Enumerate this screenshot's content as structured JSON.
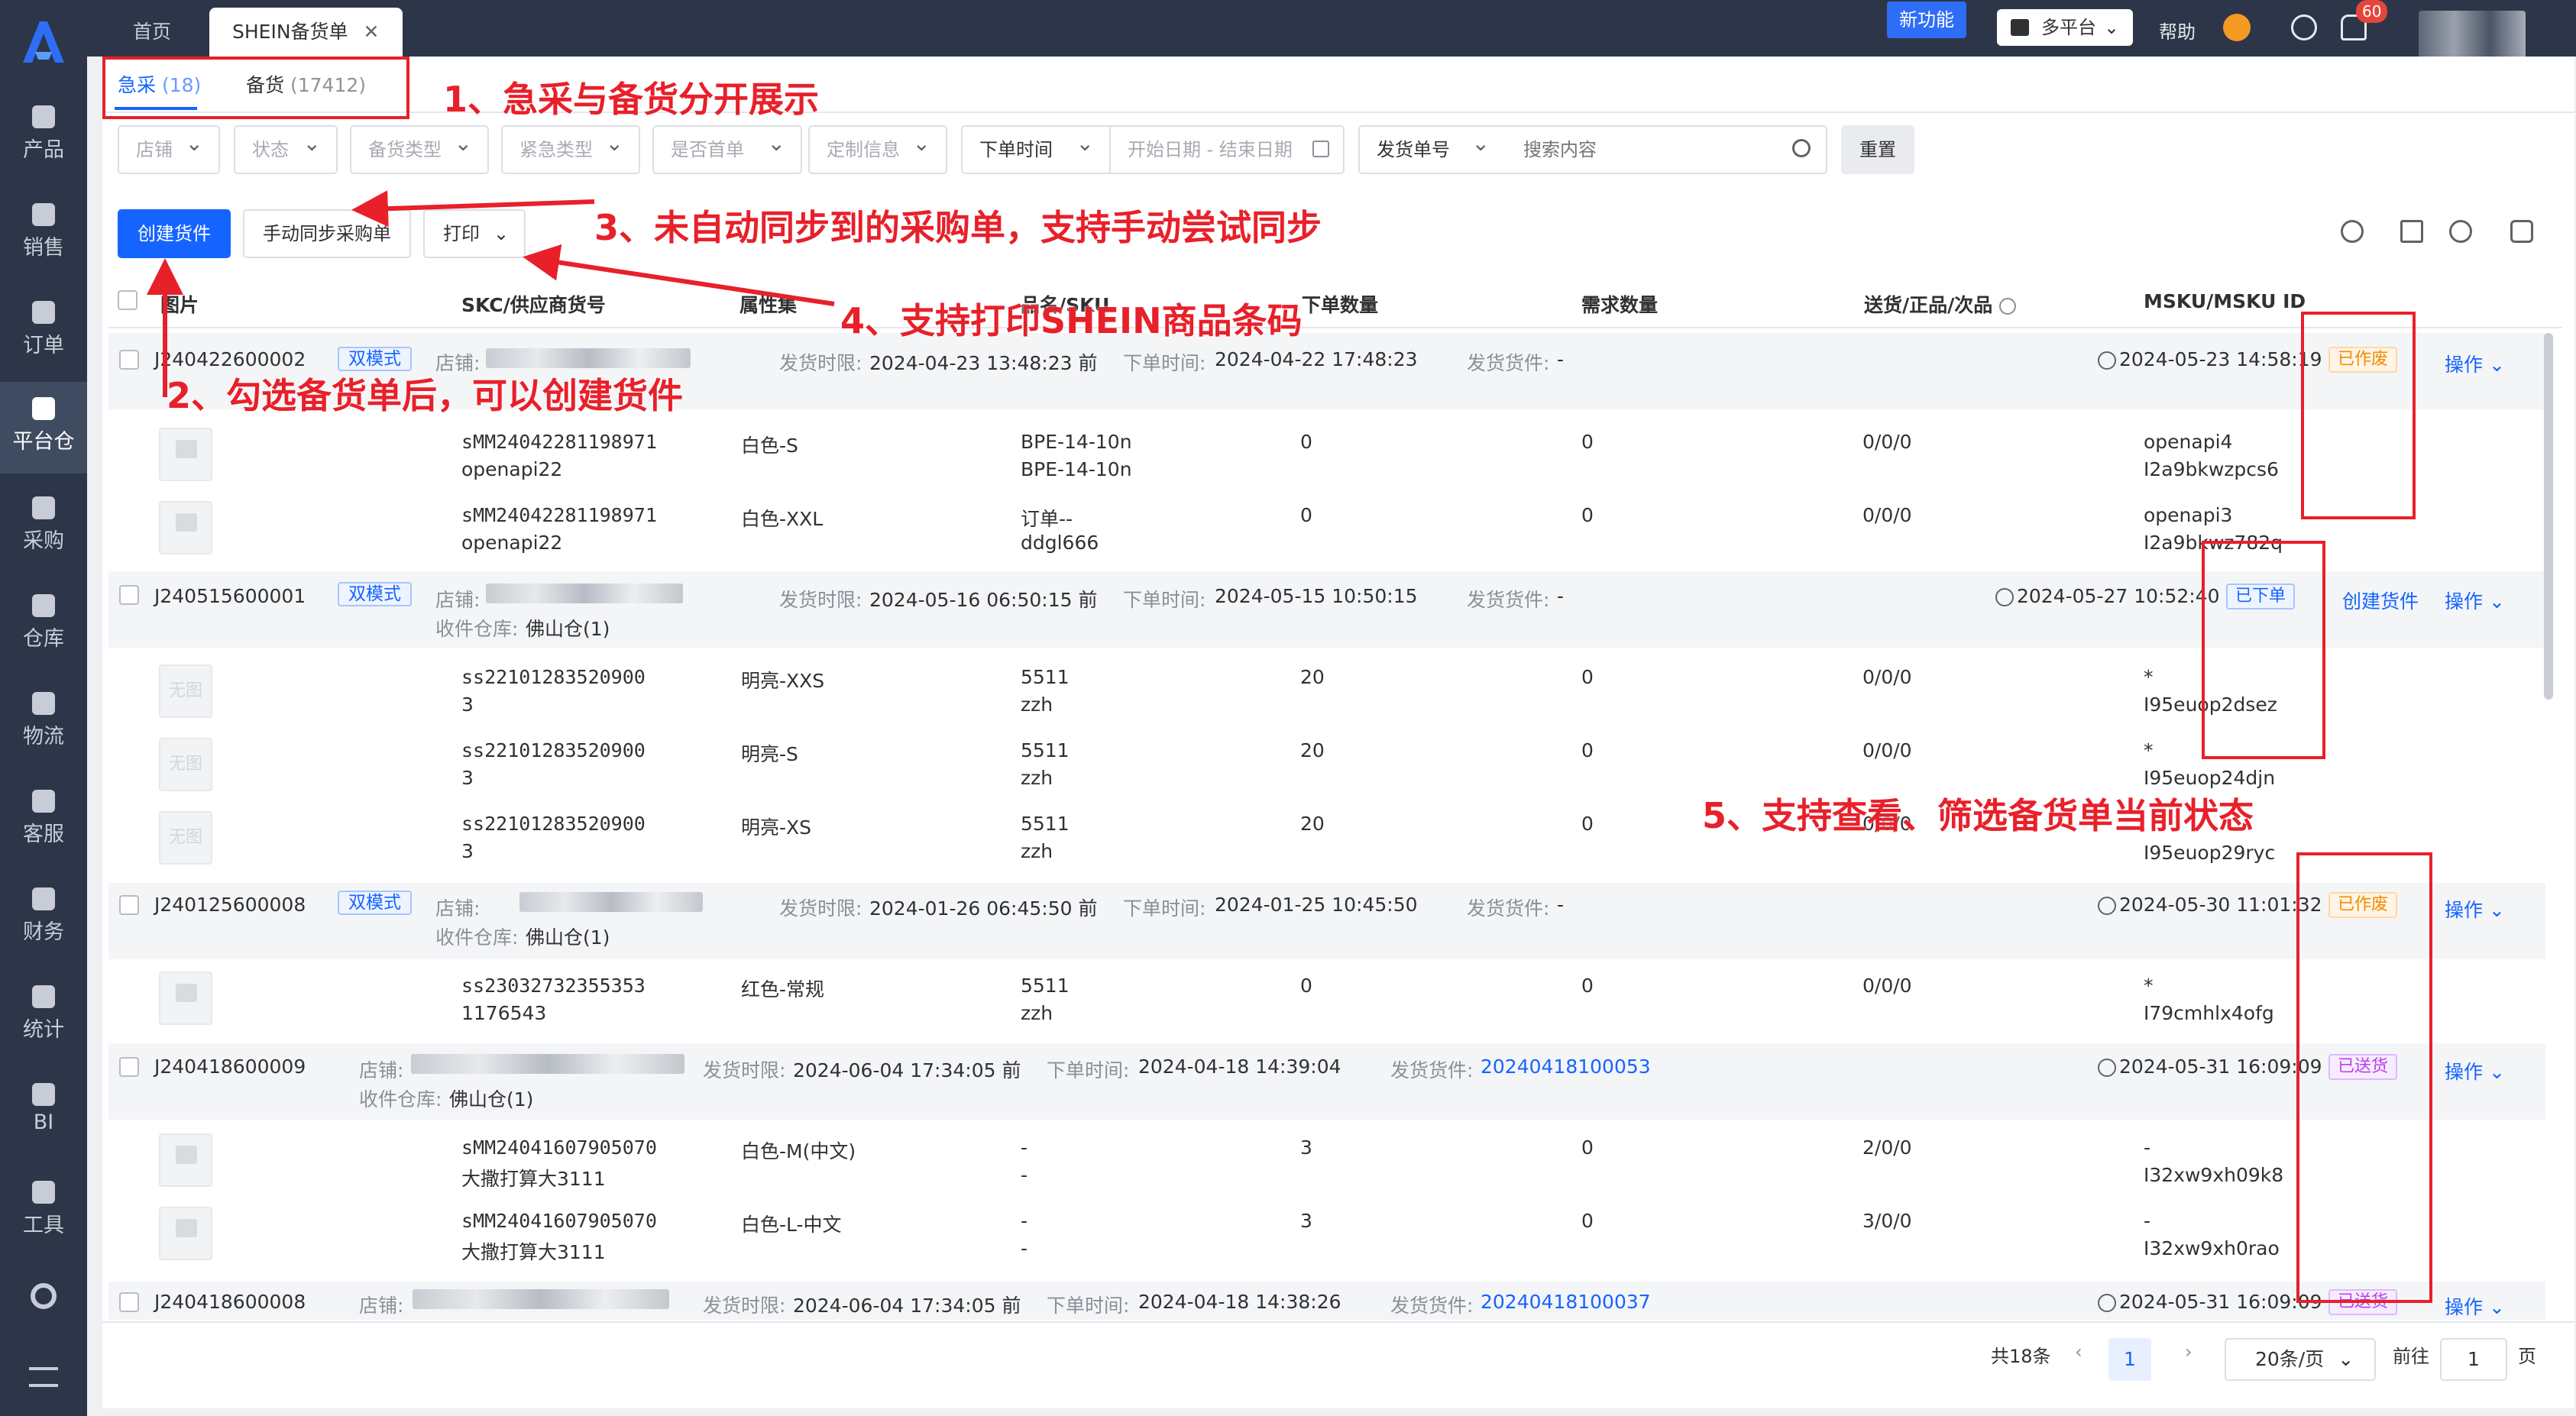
{
  "sidebar": {
    "items": [
      {
        "label": "产品",
        "icon": "product-icon"
      },
      {
        "label": "销售",
        "icon": "sales-icon"
      },
      {
        "label": "订单",
        "icon": "order-icon"
      },
      {
        "label": "平台仓",
        "icon": "platform-warehouse-icon"
      },
      {
        "label": "采购",
        "icon": "cart-icon"
      },
      {
        "label": "仓库",
        "icon": "warehouse-icon"
      },
      {
        "label": "物流",
        "icon": "truck-icon"
      },
      {
        "label": "客服",
        "icon": "mail-icon"
      },
      {
        "label": "财务",
        "icon": "yen-icon"
      },
      {
        "label": "统计",
        "icon": "pie-chart-icon"
      },
      {
        "label": "BI",
        "icon": "bi-icon"
      },
      {
        "label": "工具",
        "icon": "wrench-icon"
      }
    ]
  },
  "topbar": {
    "tabs": [
      "首页",
      "SHEIN备货单"
    ],
    "new_feature": "新功能",
    "platform": "多平台",
    "help": "帮助",
    "badge": "60"
  },
  "subtabs": [
    {
      "label": "急采",
      "count": "(18)"
    },
    {
      "label": "备货",
      "count": "(17412)"
    }
  ],
  "filters": {
    "shop": "店铺",
    "status": "状态",
    "stock_type": "备货类型",
    "urgent_type": "紧急类型",
    "first_order": "是否首单",
    "custom": "定制信息",
    "order_time": "下单时间",
    "date_range": "开始日期  -  结束日期",
    "ship_no": "发货单号",
    "search_placeholder": "搜索内容",
    "reset": "重置"
  },
  "actions": {
    "create": "创建货件",
    "sync": "手动同步采购单",
    "print": "打印"
  },
  "table": {
    "headers": [
      "图片",
      "SKC/供应商货号",
      "属性集",
      "品名/SKU",
      "下单数量",
      "需求数量",
      "送货/正品/次品",
      "MSKU/MSKU ID"
    ]
  },
  "labels": {
    "shop": "店铺:",
    "warehouse": "收件仓库:",
    "deadline": "发货时限:",
    "order_time": "下单时间:",
    "shipment": "发货货件:",
    "dual": "双模式",
    "op": "操作",
    "create": "创建货件",
    "none_img": "无图"
  },
  "orders": [
    {
      "id": "J240422600002",
      "deadline": "2024-04-23 13:48:23 前",
      "order_time": "2024-04-22 17:48:23",
      "shipment": "-",
      "time": "2024-05-23 14:58:19",
      "status": "已作废",
      "items": [
        {
          "skc": "sMM24042281198971",
          "supplier": "openapi22",
          "attr": "白色-S",
          "name": "BPE-14-10n",
          "sku": "BPE-14-10n",
          "qty": "0",
          "need": "0",
          "dlv": "0/0/0",
          "msku": "openapi4",
          "mskuid": "I2a9bkwzpcs6"
        },
        {
          "skc": "sMM24042281198971",
          "supplier": "openapi22",
          "attr": "白色-XXL",
          "name": "订单--",
          "sku": "ddgl666",
          "qty": "0",
          "need": "0",
          "dlv": "0/0/0",
          "msku": "openapi3",
          "mskuid": "I2a9bkwz782q"
        }
      ]
    },
    {
      "id": "J240515600001",
      "warehouse_val": "佛山仓(1)",
      "deadline": "2024-05-16 06:50:15 前",
      "order_time": "2024-05-15 10:50:15",
      "shipment": "-",
      "time": "2024-05-27 10:52:40",
      "status": "已下单",
      "items": [
        {
          "skc": "ss22101283520900",
          "supplier": "3",
          "attr": "明亮-XXS",
          "name": "5511",
          "sku": "zzh",
          "qty": "20",
          "need": "0",
          "dlv": "0/0/0",
          "msku": "*",
          "mskuid": "I95euop2dsez"
        },
        {
          "skc": "ss22101283520900",
          "supplier": "3",
          "attr": "明亮-S",
          "name": "5511",
          "sku": "zzh",
          "qty": "20",
          "need": "0",
          "dlv": "0/0/0",
          "msku": "*",
          "mskuid": "I95euop24djn"
        },
        {
          "skc": "ss22101283520900",
          "supplier": "3",
          "attr": "明亮-XS",
          "name": "5511",
          "sku": "zzh",
          "qty": "20",
          "need": "0",
          "dlv": "0/0/0",
          "msku": "",
          "mskuid": "I95euop29ryc"
        }
      ]
    },
    {
      "id": "J240125600008",
      "warehouse_val": "佛山仓(1)",
      "deadline": "2024-01-26 06:45:50 前",
      "order_time": "2024-01-25 10:45:50",
      "shipment": "-",
      "time": "2024-05-30 11:01:32",
      "status": "已作废",
      "items": [
        {
          "skc": "ss23032732355353",
          "supplier": "1176543",
          "attr": "红色-常规",
          "name": "5511",
          "sku": "zzh",
          "qty": "0",
          "need": "0",
          "dlv": "0/0/0",
          "msku": "*",
          "mskuid": "I79cmhlx4ofg"
        }
      ]
    },
    {
      "id": "J240418600009",
      "warehouse_val": "佛山仓(1)",
      "deadline": "2024-06-04 17:34:05 前",
      "order_time": "2024-04-18 14:39:04",
      "shipment": "20240418100053",
      "time": "2024-05-31 16:09:09",
      "status": "已送货",
      "items": [
        {
          "skc": "sMM24041607905070",
          "supplier": "大撒打算大3111",
          "attr": "白色-M(中文)",
          "name": "-",
          "sku": "-",
          "qty": "3",
          "need": "0",
          "dlv": "2/0/0",
          "msku": "-",
          "mskuid": "I32xw9xh09k8"
        },
        {
          "skc": "sMM24041607905070",
          "supplier": "大撒打算大3111",
          "attr": "白色-L-中文",
          "name": "-",
          "sku": "-",
          "qty": "3",
          "need": "0",
          "dlv": "3/0/0",
          "msku": "-",
          "mskuid": "I32xw9xh0rao"
        }
      ]
    },
    {
      "id": "J240418600008",
      "deadline": "2024-06-04 17:34:05 前",
      "order_time": "2024-04-18 14:38:26",
      "shipment": "20240418100037",
      "time": "2024-05-31 16:09:09",
      "status": "已送货"
    }
  ],
  "pagination": {
    "total": "共18条",
    "page": "1",
    "size": "20条/页",
    "goto": "前往",
    "goto_val": "1",
    "unit": "页"
  },
  "annotations": [
    "1、急采与备货分开展示",
    "2、勾选备货单后，可以创建货件",
    "3、未自动同步到的采购单，支持手动尝试同步",
    "4、支持打印SHEIN商品条码",
    "5、支持查看、筛选备货单当前状态"
  ],
  "colors": {
    "accent": "#1664ff",
    "annotation": "#e8202a",
    "sidebar": "#2c3648"
  }
}
